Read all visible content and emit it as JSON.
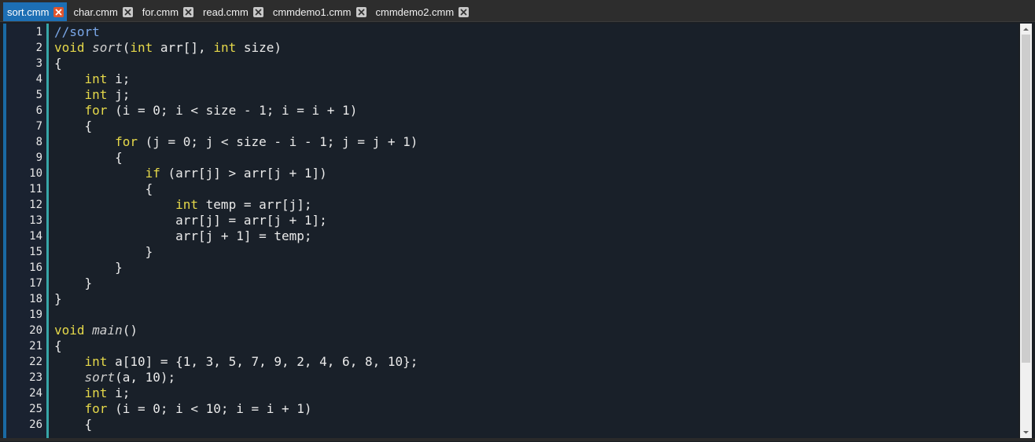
{
  "tabs": [
    {
      "label": "sort.cmm",
      "active": true
    },
    {
      "label": "char.cmm",
      "active": false
    },
    {
      "label": "for.cmm",
      "active": false
    },
    {
      "label": "read.cmm",
      "active": false
    },
    {
      "label": "cmmdemo1.cmm",
      "active": false
    },
    {
      "label": "cmmdemo2.cmm",
      "active": false
    }
  ],
  "line_numbers": [
    "1",
    "2",
    "3",
    "4",
    "5",
    "6",
    "7",
    "8",
    "9",
    "10",
    "11",
    "12",
    "13",
    "14",
    "15",
    "16",
    "17",
    "18",
    "19",
    "20",
    "21",
    "22",
    "23",
    "24",
    "25",
    "26"
  ],
  "code_lines": [
    [
      {
        "t": "//sort",
        "c": "cm"
      }
    ],
    [
      {
        "t": "void",
        "c": "kw"
      },
      {
        "t": " "
      },
      {
        "t": "sort",
        "c": "fn"
      },
      {
        "t": "("
      },
      {
        "t": "int",
        "c": "kw"
      },
      {
        "t": " arr[], "
      },
      {
        "t": "int",
        "c": "kw"
      },
      {
        "t": " size)"
      }
    ],
    [
      {
        "t": "{"
      }
    ],
    [
      {
        "t": "    "
      },
      {
        "t": "int",
        "c": "kw"
      },
      {
        "t": " i;"
      }
    ],
    [
      {
        "t": "    "
      },
      {
        "t": "int",
        "c": "kw"
      },
      {
        "t": " j;"
      }
    ],
    [
      {
        "t": "    "
      },
      {
        "t": "for",
        "c": "kw"
      },
      {
        "t": " (i = 0; i < size - 1; i = i + 1)"
      }
    ],
    [
      {
        "t": "    {"
      }
    ],
    [
      {
        "t": "        "
      },
      {
        "t": "for",
        "c": "kw"
      },
      {
        "t": " (j = 0; j < size - i - 1; j = j + 1)"
      }
    ],
    [
      {
        "t": "        {"
      }
    ],
    [
      {
        "t": "            "
      },
      {
        "t": "if",
        "c": "kw"
      },
      {
        "t": " (arr[j] > arr[j + 1])"
      }
    ],
    [
      {
        "t": "            {"
      }
    ],
    [
      {
        "t": "                "
      },
      {
        "t": "int",
        "c": "kw"
      },
      {
        "t": " temp = arr[j];"
      }
    ],
    [
      {
        "t": "                arr[j] = arr[j + 1];"
      }
    ],
    [
      {
        "t": "                arr[j + 1] = temp;"
      }
    ],
    [
      {
        "t": "            }"
      }
    ],
    [
      {
        "t": "        }"
      }
    ],
    [
      {
        "t": "    }"
      }
    ],
    [
      {
        "t": "}"
      }
    ],
    [],
    [
      {
        "t": "void",
        "c": "kw"
      },
      {
        "t": " "
      },
      {
        "t": "main",
        "c": "fn"
      },
      {
        "t": "()"
      }
    ],
    [
      {
        "t": "{"
      }
    ],
    [
      {
        "t": "    "
      },
      {
        "t": "int",
        "c": "kw"
      },
      {
        "t": " a[10] = {1, 3, 5, 7, 9, 2, 4, 6, 8, 10};"
      }
    ],
    [
      {
        "t": "    "
      },
      {
        "t": "sort",
        "c": "fn"
      },
      {
        "t": "(a, 10);"
      }
    ],
    [
      {
        "t": "    "
      },
      {
        "t": "int",
        "c": "kw"
      },
      {
        "t": " i;"
      }
    ],
    [
      {
        "t": "    "
      },
      {
        "t": "for",
        "c": "kw"
      },
      {
        "t": " (i = 0; i < 10; i = i + 1)"
      }
    ],
    [
      {
        "t": "    {"
      }
    ]
  ],
  "colors": {
    "keyword": "#e6d94a",
    "comment": "#7aa7e8",
    "active_tab": "#1d6fb4",
    "gutter_accent": "#38a6a8"
  }
}
